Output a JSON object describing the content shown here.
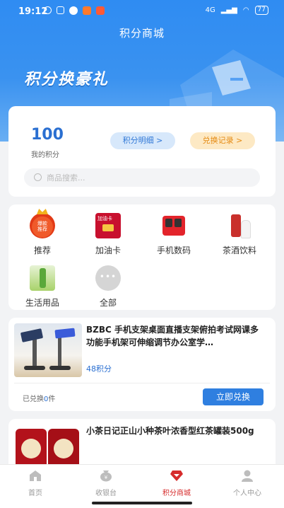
{
  "status_bar": {
    "time": "19:12",
    "signal": "4G",
    "battery": "77"
  },
  "header": {
    "title": "积分商城",
    "banner_text": "积分换豪礼"
  },
  "points": {
    "value": "100",
    "label": "我的积分",
    "detail_button": "积分明细 >",
    "record_button": "兑换记录 >"
  },
  "search": {
    "placeholder": "商品搜索..."
  },
  "categories": [
    {
      "label": "推荐",
      "icon": "recommend-badge-icon"
    },
    {
      "label": "加油卡",
      "icon": "fuel-card-icon"
    },
    {
      "label": "手机数码",
      "icon": "phone-digital-icon"
    },
    {
      "label": "茶酒饮料",
      "icon": "tea-wine-icon"
    },
    {
      "label": "生活用品",
      "icon": "daily-goods-icon"
    },
    {
      "label": "全部",
      "icon": "more-dots-icon"
    }
  ],
  "products": [
    {
      "title": "BZBC 手机支架桌面直播支架俯拍考试网课多功能手机架可伸缩调节办公室学…",
      "price": "48积分",
      "sold_prefix": "已兑换",
      "sold_count": "0",
      "sold_suffix": "件",
      "button": "立即兑换"
    },
    {
      "title": "小茶日记正山小种茶叶浓香型红茶罐装500g"
    }
  ],
  "tabs": [
    {
      "label": "首页",
      "icon": "home-icon"
    },
    {
      "label": "收银台",
      "icon": "cashier-icon"
    },
    {
      "label": "积分商城",
      "icon": "gem-icon"
    },
    {
      "label": "个人中心",
      "icon": "user-icon"
    }
  ],
  "colors": {
    "primary": "#2f8cf2",
    "accent_red": "#d62b2b",
    "points_blue": "#2a6fd1"
  }
}
